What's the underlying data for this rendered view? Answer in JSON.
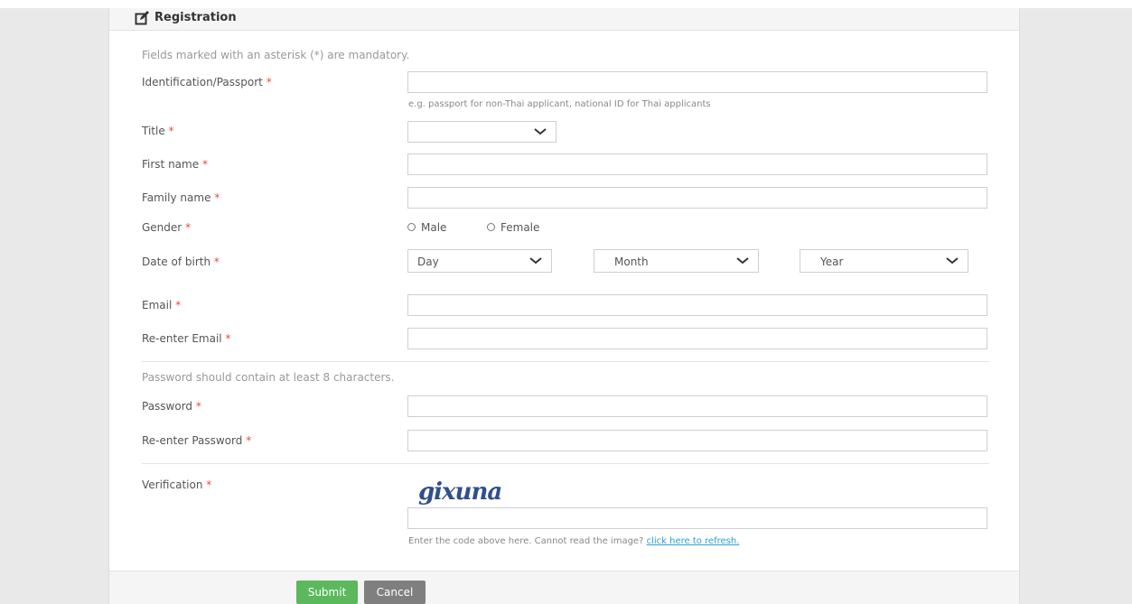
{
  "header": {
    "title": "Registration",
    "icon": "edit-icon"
  },
  "mandatory_note": "Fields marked with an asterisk (*) are mandatory.",
  "required_mark": "*",
  "fields": {
    "id": {
      "label": "Identification/Passport",
      "value": "",
      "help": "e.g. passport for non-Thai applicant, national ID for Thai applicants"
    },
    "title": {
      "label": "Title",
      "value": ""
    },
    "first_name": {
      "label": "First name",
      "value": ""
    },
    "family_name": {
      "label": "Family name",
      "value": ""
    },
    "gender": {
      "label": "Gender",
      "options": [
        "Male",
        "Female"
      ]
    },
    "dob": {
      "label": "Date of birth",
      "day": "Day",
      "month": "Month",
      "year": "Year"
    },
    "email": {
      "label": "Email",
      "value": ""
    },
    "email_confirm": {
      "label": "Re-enter Email",
      "value": ""
    },
    "password": {
      "label": "Password",
      "value": ""
    },
    "password_confirm": {
      "label": "Re-enter Password",
      "value": ""
    },
    "verification": {
      "label": "Verification",
      "captcha_text": "gixuna",
      "value": ""
    }
  },
  "password_note": "Password should contain at least 8 characters.",
  "verification_help": "Enter the code above here. Cannot read the image?",
  "refresh_link": "click here to refresh.",
  "buttons": {
    "submit": "Submit",
    "cancel": "Cancel"
  },
  "colors": {
    "required": "#e74c3c",
    "submit": "#5cb85c",
    "cancel": "#7f7f7f",
    "link": "#2a9fd6",
    "captcha": "#2f4f8f"
  }
}
